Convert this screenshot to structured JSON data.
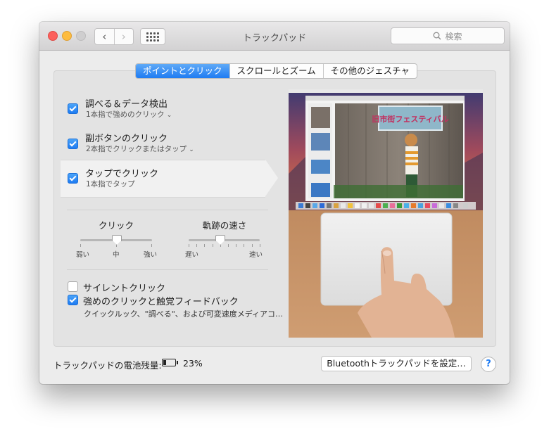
{
  "window": {
    "title": "トラックパッド"
  },
  "toolbar": {
    "back_label": "‹",
    "forward_label": "›",
    "search_placeholder": "検索"
  },
  "tabs": [
    {
      "label": "ポイントとクリック",
      "active": true
    },
    {
      "label": "スクロールとズーム",
      "active": false
    },
    {
      "label": "その他のジェスチャ",
      "active": false
    }
  ],
  "options": [
    {
      "label": "調べる＆データ検出",
      "sub": "1本指で強めのクリック",
      "checked": true,
      "has_menu": true
    },
    {
      "label": "副ボタンのクリック",
      "sub": "2本指でクリックまたはタップ",
      "checked": true,
      "has_menu": true
    },
    {
      "label": "タップでクリック",
      "sub": "1本指でタップ",
      "checked": true,
      "has_menu": false
    }
  ],
  "sliders": {
    "click": {
      "label": "クリック",
      "min_label": "弱い",
      "mid_label": "中",
      "max_label": "強い",
      "value": 0.5
    },
    "tracking": {
      "label": "軌跡の速さ",
      "min_label": "遅い",
      "max_label": "速い",
      "value": 0.44
    }
  },
  "bottom_options": [
    {
      "label": "サイレントクリック",
      "checked": false
    },
    {
      "label": "強めのクリックと触覚フィードバック",
      "checked": true,
      "description": "クイックルック、\"調べる\"、および可変速度メディアコ…"
    }
  ],
  "footer": {
    "battery_label": "トラックパッドの電池残量:",
    "battery_percent": "23%",
    "battery_level": 0.23,
    "setup_button": "Bluetoothトラックパッドを設定…",
    "help_label": "?"
  },
  "preview": {
    "banner_text": "旧市街フェスティバル"
  },
  "colors": {
    "accent": "#1e7bf2",
    "window_bg": "#ececec"
  }
}
